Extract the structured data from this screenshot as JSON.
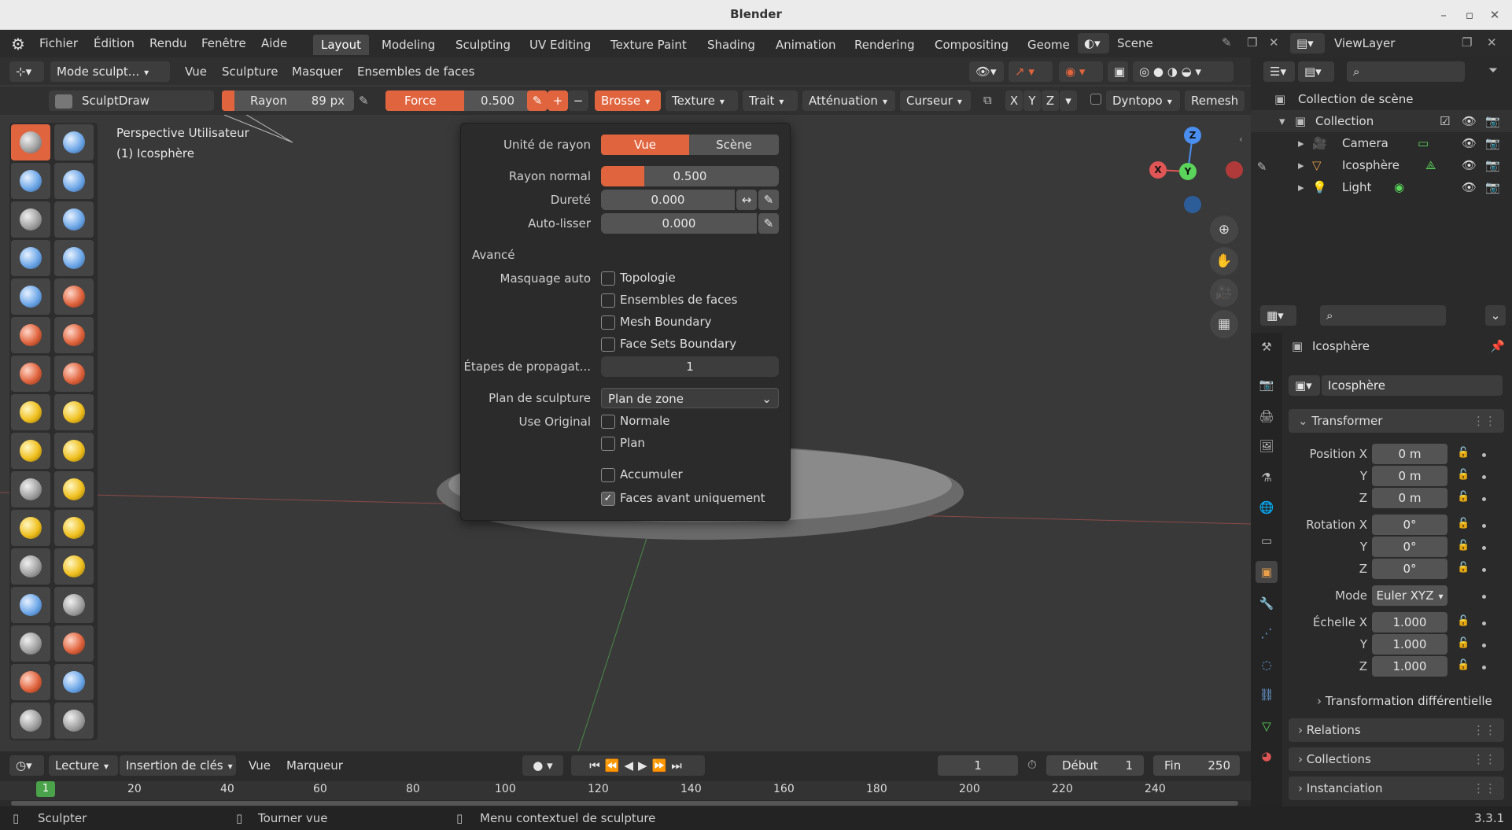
{
  "window": {
    "title": "Blender"
  },
  "menu": {
    "items": [
      "Fichier",
      "Édition",
      "Rendu",
      "Fenêtre",
      "Aide"
    ]
  },
  "workspaces": [
    "Layout",
    "Modeling",
    "Sculpting",
    "UV Editing",
    "Texture Paint",
    "Shading",
    "Animation",
    "Rendering",
    "Compositing",
    "Geome"
  ],
  "scene": {
    "name": "Scene",
    "view_layer": "ViewLayer"
  },
  "header": {
    "mode": "Mode sculpt...",
    "items": [
      "Vue",
      "Sculpture",
      "Masquer",
      "Ensembles de faces"
    ]
  },
  "toolsettings": {
    "brush_name": "SculptDraw",
    "radius_label": "Rayon",
    "radius_value": "89 px",
    "strength_label": "Force",
    "strength_value": "0.500",
    "brush_menu": "Brosse",
    "texture": "Texture",
    "stroke": "Trait",
    "falloff": "Atténuation",
    "cursor": "Curseur",
    "sym_x": "X",
    "sym_y": "Y",
    "sym_z": "Z",
    "dyntopo": "Dyntopo",
    "remesh": "Remesh"
  },
  "viewport": {
    "perspective": "Perspective Utilisateur",
    "object": "(1) Icosphère"
  },
  "popup": {
    "radius_unit_label": "Unité de rayon",
    "unit_view": "Vue",
    "unit_scene": "Scène",
    "normal_radius_label": "Rayon normal",
    "normal_radius_value": "0.500",
    "normal_radius_fill": 0.5,
    "hardness_label": "Dureté",
    "hardness_value": "0.000",
    "autosmooth_label": "Auto-lisser",
    "autosmooth_value": "0.000",
    "advanced_label": "Avancé",
    "automask_label": "Masquage auto",
    "automask_options": [
      {
        "label": "Topologie",
        "checked": false
      },
      {
        "label": "Ensembles de faces",
        "checked": false
      },
      {
        "label": "Mesh Boundary",
        "checked": false
      },
      {
        "label": "Face Sets Boundary",
        "checked": false
      }
    ],
    "propagation_label": "Étapes de propagat...",
    "propagation_value": "1",
    "sculpt_plane_label": "Plan de sculpture",
    "sculpt_plane_value": "Plan de zone",
    "use_original_label": "Use Original",
    "use_original_options": [
      {
        "label": "Normale",
        "checked": false
      },
      {
        "label": "Plan",
        "checked": false
      }
    ],
    "accumulate_label": "Accumuler",
    "accumulate_checked": false,
    "front_faces_label": "Faces avant uniquement",
    "front_faces_checked": true
  },
  "gizmo": {
    "x": "X",
    "y": "Y",
    "z": "Z"
  },
  "outliner": {
    "root": "Collection de scène",
    "collection": "Collection",
    "items": [
      {
        "name": "Camera"
      },
      {
        "name": "Icosphère"
      },
      {
        "name": "Light"
      }
    ]
  },
  "properties": {
    "object_name": "Icosphère",
    "datablock": "Icosphère",
    "transform_label": "Transformer",
    "location_label": "Position X",
    "rotation_label": "Rotation X",
    "scale_label": "Échelle X",
    "y_label": "Y",
    "z_label": "Z",
    "location": [
      "0 m",
      "0 m",
      "0 m"
    ],
    "rotation": [
      "0°",
      "0°",
      "0°"
    ],
    "mode_label": "Mode",
    "mode_value": "Euler XYZ",
    "scale": [
      "1.000",
      "1.000",
      "1.000"
    ],
    "delta_label": "Transformation différentielle",
    "relations_label": "Relations",
    "collections_label": "Collections",
    "instancing_label": "Instanciation"
  },
  "timeline": {
    "playback": "Lecture",
    "keying": "Insertion de clés",
    "view": "Vue",
    "marker": "Marqueur",
    "current_frame": "1",
    "start_label": "Début",
    "start_value": "1",
    "end_label": "Fin",
    "end_value": "250",
    "ruler": [
      "20",
      "40",
      "60",
      "80",
      "100",
      "120",
      "140",
      "160",
      "180",
      "200",
      "220",
      "240"
    ],
    "frame_marker": "1"
  },
  "status": {
    "left": "Sculpter",
    "middle": "Tourner vue",
    "right": "Menu contextuel de sculpture",
    "version": "3.3.1"
  },
  "colors": {
    "accent": "#e0643e",
    "x_axis": "#e05555",
    "y_axis": "#5ad45a",
    "z_axis": "#4a8ef0"
  }
}
